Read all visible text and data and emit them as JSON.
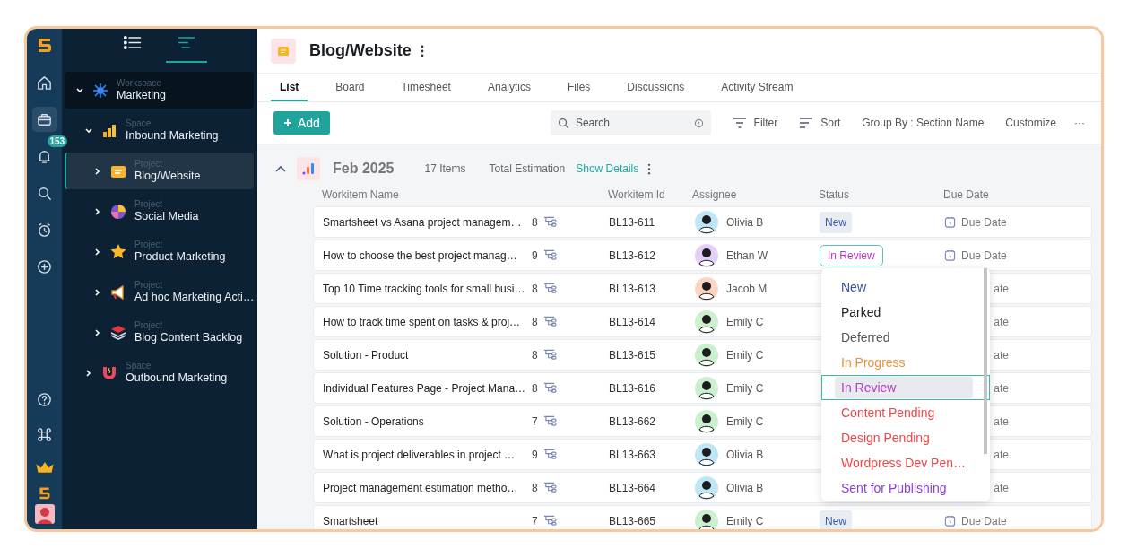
{
  "rail": {
    "items": [
      {
        "selected": false
      },
      {
        "selected": true
      },
      {
        "selected": false,
        "badge": "153"
      },
      {
        "selected": false
      },
      {
        "selected": false
      },
      {
        "selected": false
      }
    ]
  },
  "sidebar": {
    "views": [
      {
        "selected": false
      },
      {
        "selected": true
      }
    ],
    "tree": [
      {
        "type": "Workspace",
        "name": "Marketing",
        "expanded": true,
        "selected": false,
        "children": [
          {
            "type": "Space",
            "name": "Inbound Marketing",
            "expanded": true,
            "selected": false,
            "children": [
              {
                "type": "Project",
                "name": "Blog/Website",
                "expanded": false,
                "selected": true
              },
              {
                "type": "Project",
                "name": "Social Media",
                "expanded": false,
                "selected": false
              },
              {
                "type": "Project",
                "name": "Product Marketing",
                "expanded": false,
                "selected": false
              },
              {
                "type": "Project",
                "name": "Ad hoc Marketing Acti…",
                "expanded": false,
                "selected": false
              },
              {
                "type": "Project",
                "name": "Blog Content Backlog",
                "expanded": false,
                "selected": false
              }
            ]
          },
          {
            "type": "Space",
            "name": "Outbound Marketing",
            "expanded": false,
            "selected": false
          }
        ]
      }
    ]
  },
  "header": {
    "title": "Blog/Website"
  },
  "tabs": [
    {
      "label": "List",
      "selected": true
    },
    {
      "label": "Board",
      "selected": false
    },
    {
      "label": "Timesheet",
      "selected": false
    },
    {
      "label": "Analytics",
      "selected": false
    },
    {
      "label": "Files",
      "selected": false
    },
    {
      "label": "Discussions",
      "selected": false
    },
    {
      "label": "Activity Stream",
      "selected": false
    }
  ],
  "toolbar": {
    "add": "Add",
    "search": {
      "placeholder": "Search"
    },
    "filter": "Filter",
    "sort": "Sort",
    "group_by": "Group By : Section Name",
    "customize": "Customize",
    "more": "···"
  },
  "group": {
    "expanded": true,
    "title": "Feb 2025",
    "count": "17 Items",
    "estimation": "Total Estimation",
    "details_link": "Show Details"
  },
  "table": {
    "columns": [
      "Workitem Name",
      "Workitem Id",
      "Assignee",
      "Status",
      "Due Date"
    ],
    "rows": [
      {
        "name": "Smartsheet vs Asana project managem…",
        "estimate": "8",
        "id": "BL13-611",
        "assignee": {
          "name": "Olivia B",
          "color": "#bfe6f7"
        },
        "status": {
          "label": "New",
          "color": "#3b5aa8",
          "open": false
        },
        "due": "Due Date"
      },
      {
        "name": "How to choose the best project manag…",
        "estimate": "9",
        "id": "BL13-612",
        "assignee": {
          "name": "Ethan W",
          "color": "#e3d0f8"
        },
        "status": {
          "label": "In Review",
          "color": "#b03cc9",
          "open": true
        },
        "due": "Due Date"
      },
      {
        "name": "Top 10 Time tracking tools for small busi…",
        "estimate": "8",
        "id": "BL13-613",
        "assignee": {
          "name": "Jacob M",
          "color": "#fbd5c2"
        },
        "due_tail": "ate"
      },
      {
        "name": "How to track time spent on tasks & proj…",
        "estimate": "8",
        "id": "BL13-614",
        "assignee": {
          "name": "Emily C",
          "color": "#caf0cd"
        },
        "due_tail": "ate"
      },
      {
        "name": "Solution - Product",
        "estimate": "8",
        "id": "BL13-615",
        "assignee": {
          "name": "Emily C",
          "color": "#caf0cd"
        },
        "due_tail": "ate"
      },
      {
        "name": "Individual Features Page - Project Mana…",
        "estimate": "8",
        "id": "BL13-616",
        "assignee": {
          "name": "Emily C",
          "color": "#caf0cd"
        },
        "due_tail": "ate"
      },
      {
        "name": "Solution - Operations",
        "estimate": "7",
        "id": "BL13-662",
        "assignee": {
          "name": "Emily C",
          "color": "#caf0cd"
        },
        "due_tail": "ate"
      },
      {
        "name": "What is project deliverables in project …",
        "estimate": "9",
        "id": "BL13-663",
        "assignee": {
          "name": "Olivia B",
          "color": "#bfe6f7"
        },
        "due_tail": "ate"
      },
      {
        "name": "Project management estimation metho…",
        "estimate": "8",
        "id": "BL13-664",
        "assignee": {
          "name": "Olivia B",
          "color": "#bfe6f7"
        },
        "due_tail": "ate"
      },
      {
        "name": "Smartsheet",
        "estimate": "7",
        "id": "BL13-665",
        "assignee": {
          "name": "Emily C",
          "color": "#caf0cd"
        },
        "status": {
          "label": "New",
          "color": "#3b5aa8",
          "open": false
        },
        "due": "Due Date"
      }
    ]
  },
  "status_menu": {
    "options": [
      {
        "label": "New",
        "color": "#3b4fa0",
        "selected": false
      },
      {
        "label": "Parked",
        "color": "#222222",
        "selected": false
      },
      {
        "label": "Deferred",
        "color": "#555555",
        "selected": false
      },
      {
        "label": "In Progress",
        "color": "#e8913a",
        "selected": false
      },
      {
        "label": "In Review",
        "color": "#b03cc9",
        "selected": true
      },
      {
        "label": "Content Pending",
        "color": "#f04646",
        "selected": false
      },
      {
        "label": "Design Pending",
        "color": "#f04646",
        "selected": false
      },
      {
        "label": "Wordpress Dev Pen…",
        "color": "#f04646",
        "selected": false
      },
      {
        "label": "Sent for Publishing",
        "color": "#8a3fd6",
        "selected": false
      }
    ]
  }
}
